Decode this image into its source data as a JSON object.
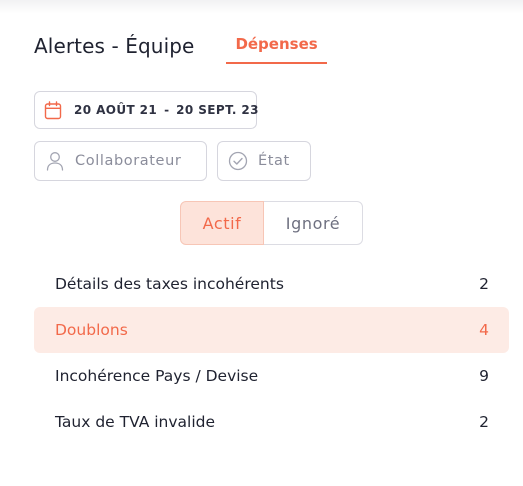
{
  "header": {
    "title": "Alertes - Équipe",
    "tab_label": "Dépenses"
  },
  "date_range": {
    "start": "20 AOÛT 21",
    "separator": "-",
    "end": "20 SEPT. 23",
    "icon": "calendar-icon"
  },
  "filters": {
    "collaborator_label": "Collaborateur",
    "collaborator_icon": "user-icon",
    "state_label": "État",
    "state_icon": "check-circle-icon"
  },
  "status_toggle": {
    "active_label": "Actif",
    "ignored_label": "Ignoré",
    "selected": "Actif"
  },
  "alerts": [
    {
      "label": "Détails des taxes incohérents",
      "count": "2",
      "selected": false
    },
    {
      "label": "Doublons",
      "count": "4",
      "selected": true
    },
    {
      "label": "Incohérence Pays / Devise",
      "count": "9",
      "selected": false
    },
    {
      "label": "Taux de TVA invalide",
      "count": "2",
      "selected": false
    }
  ],
  "colors": {
    "accent": "#f2694a",
    "selected_row_bg": "#fdebe5",
    "active_toggle_bg": "#fde3da",
    "border": "#d6d6de",
    "muted_text": "#8b8d9b"
  }
}
